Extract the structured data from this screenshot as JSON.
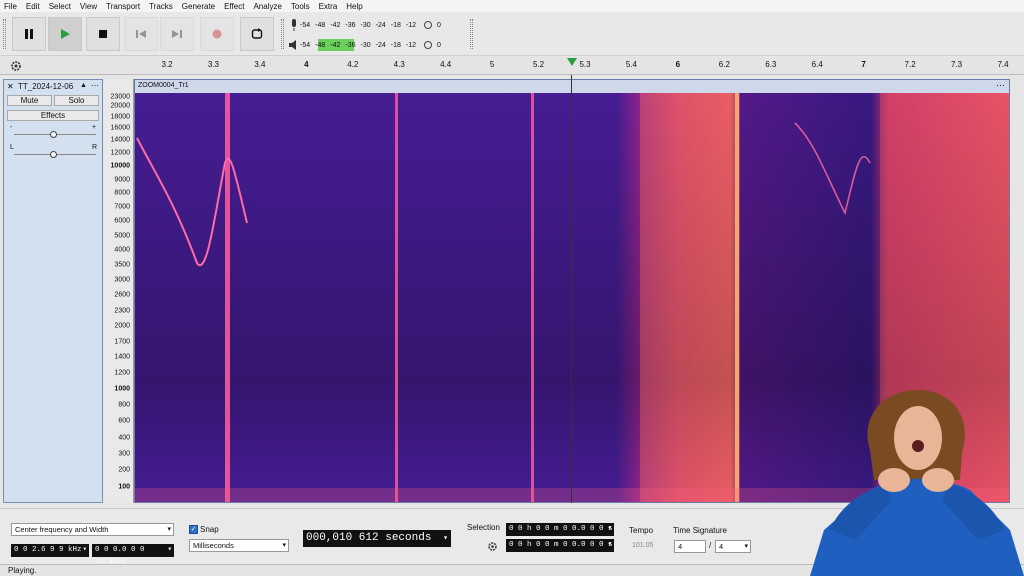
{
  "menu": [
    "File",
    "Edit",
    "Select",
    "View",
    "Transport",
    "Tracks",
    "Generate",
    "Effect",
    "Analyze",
    "Tools",
    "Extra",
    "Help"
  ],
  "meters": {
    "record_scale": [
      "-54",
      "-48",
      "-42",
      "-36",
      "-30",
      "-24",
      "-18",
      "-12",
      "0"
    ],
    "play_scale": [
      "-54",
      "-48",
      "-42",
      "-36",
      "-30",
      "-24",
      "-18",
      "-12",
      "0"
    ],
    "play_level": 0.24
  },
  "ruler": {
    "ticks": [
      {
        "label": "3.2",
        "major": false
      },
      {
        "label": "3.3",
        "major": false
      },
      {
        "label": "3.4",
        "major": false
      },
      {
        "label": "4",
        "major": true
      },
      {
        "label": "4.2",
        "major": false
      },
      {
        "label": "4.3",
        "major": false
      },
      {
        "label": "4.4",
        "major": false
      },
      {
        "label": "5",
        "major": false
      },
      {
        "label": "5.2",
        "major": false
      },
      {
        "label": "5.3",
        "major": false
      },
      {
        "label": "5.4",
        "major": false
      },
      {
        "label": "6",
        "major": true
      },
      {
        "label": "6.2",
        "major": false
      },
      {
        "label": "6.3",
        "major": false
      },
      {
        "label": "6.4",
        "major": false
      },
      {
        "label": "7",
        "major": true
      },
      {
        "label": "7.2",
        "major": false
      },
      {
        "label": "7.3",
        "major": false
      },
      {
        "label": "7.4",
        "major": false
      }
    ]
  },
  "track": {
    "name": "TT_2024-12-06",
    "mute_label": "Mute",
    "solo_label": "Solo",
    "effects_label": "Effects",
    "gain_minus": "-",
    "gain_plus": "+",
    "pan_left": "L",
    "pan_right": "R",
    "clip_name": "ZOOM0004_Tr1"
  },
  "spectrogram": {
    "freq_labels": [
      {
        "label": "23000",
        "bold": false
      },
      {
        "label": "20000",
        "bold": false
      },
      {
        "label": "18000",
        "bold": false
      },
      {
        "label": "16000",
        "bold": false
      },
      {
        "label": "14000",
        "bold": false
      },
      {
        "label": "12000",
        "bold": false
      },
      {
        "label": "10000",
        "bold": true
      },
      {
        "label": "9000",
        "bold": false
      },
      {
        "label": "8000",
        "bold": false
      },
      {
        "label": "7000",
        "bold": false
      },
      {
        "label": "6000",
        "bold": false
      },
      {
        "label": "5000",
        "bold": false
      },
      {
        "label": "4000",
        "bold": false
      },
      {
        "label": "3500",
        "bold": false
      },
      {
        "label": "3000",
        "bold": false
      },
      {
        "label": "2600",
        "bold": false
      },
      {
        "label": "2300",
        "bold": false
      },
      {
        "label": "2000",
        "bold": false
      },
      {
        "label": "1700",
        "bold": false
      },
      {
        "label": "1400",
        "bold": false
      },
      {
        "label": "1200",
        "bold": false
      },
      {
        "label": "1000",
        "bold": true
      },
      {
        "label": "800",
        "bold": false
      },
      {
        "label": "600",
        "bold": false
      },
      {
        "label": "400",
        "bold": false
      },
      {
        "label": "300",
        "bold": false
      },
      {
        "label": "200",
        "bold": false
      },
      {
        "label": "100",
        "bold": true
      }
    ]
  },
  "bottom": {
    "spectral_mode": "Center frequency and Width",
    "center_freq": "0 0 2.6 9 9 kHz",
    "width": "0 0 0.0 0 0 octaves",
    "snap_label": "Snap",
    "snap_unit": "Milliseconds",
    "time_display": "000,010 612 seconds",
    "selection_label": "Selection",
    "sel_start": "0 0 h 0 0 m 0 0.0 0 0 s",
    "sel_end": "0 0 h 0 0 m 0 0.0 0 0 s",
    "tempo_label": "Tempo",
    "tempo_value": "101.05",
    "timesig_label": "Time Signature",
    "timesig_num": "4",
    "timesig_sep": "/",
    "timesig_den": "4"
  },
  "status": "Playing.",
  "colors": {
    "accent": "#2a9d3c",
    "meter": "#6ad05a",
    "spectrum_dark": "#1b1050",
    "spectrum_hot": "#ff5fa0"
  }
}
